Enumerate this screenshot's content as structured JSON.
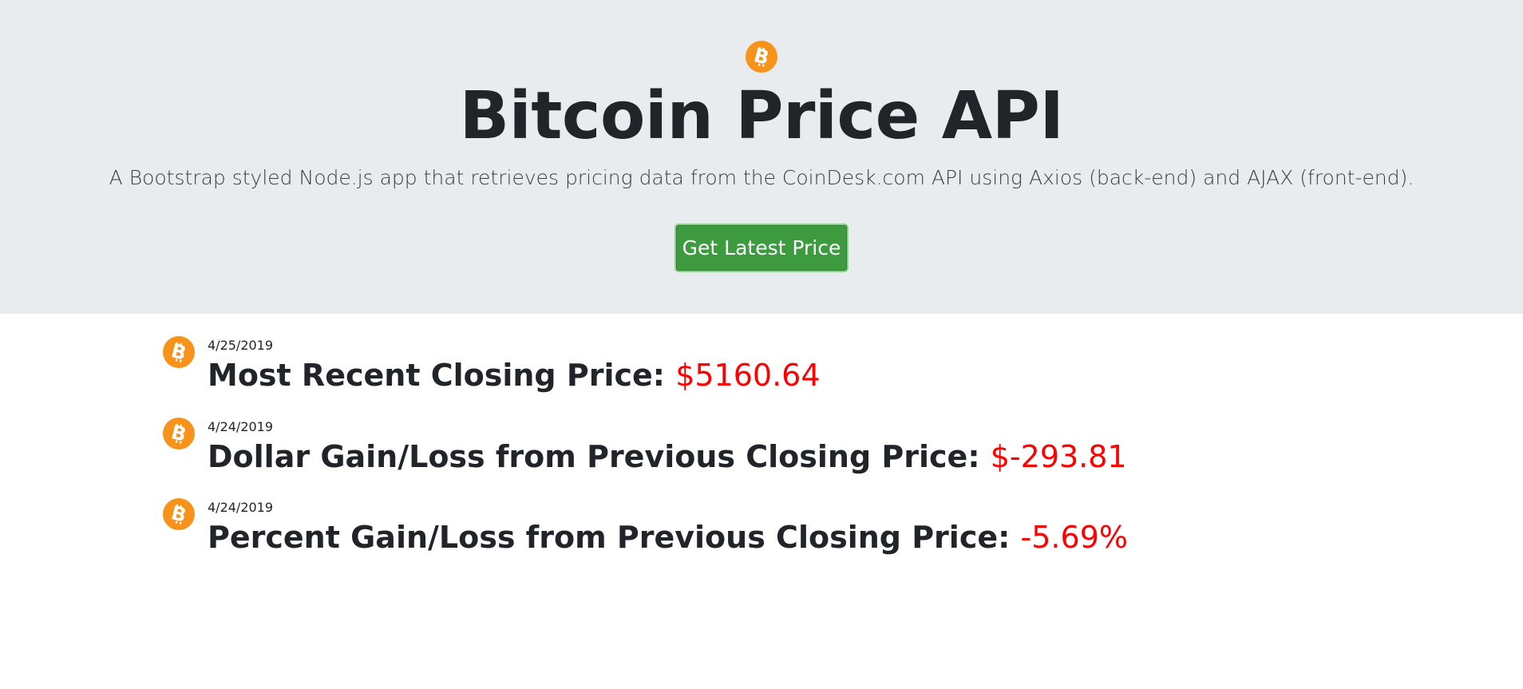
{
  "header": {
    "logo_icon": "bitcoin-icon",
    "title": "Bitcoin Price API",
    "subtitle": "A Bootstrap styled Node.js app that retrieves pricing data from the CoinDesk.com API using Axios (back-end) and AJAX (front-end).",
    "button_label": "Get Latest Price",
    "background_color": "#e9ecef",
    "button_color": "#3d9a3f"
  },
  "results": [
    {
      "icon": "bitcoin-icon",
      "date": "4/25/2019",
      "label": "Most Recent Closing Price:",
      "value": "$5160.64"
    },
    {
      "icon": "bitcoin-icon",
      "date": "4/24/2019",
      "label": "Dollar Gain/Loss from Previous Closing Price:",
      "value": "$-293.81"
    },
    {
      "icon": "bitcoin-icon",
      "date": "4/24/2019",
      "label": "Percent Gain/Loss from Previous Closing Price:",
      "value": "-5.69%"
    }
  ],
  "colors": {
    "bitcoin_orange": "#f7931a",
    "value_red": "#ff0000"
  }
}
